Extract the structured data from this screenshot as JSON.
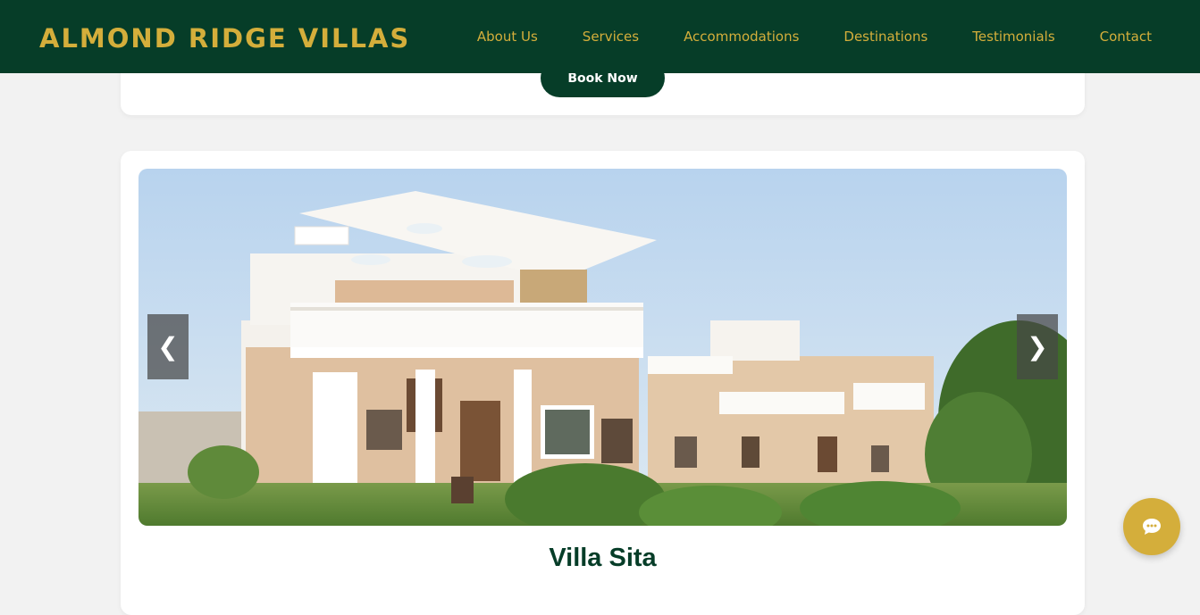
{
  "header": {
    "brand": "ALMOND RIDGE VILLAS",
    "nav": [
      "About Us",
      "Services",
      "Accommodations",
      "Destinations",
      "Testimonials",
      "Contact"
    ]
  },
  "booking": {
    "button_label": "Book Now"
  },
  "villa": {
    "name": "Villa Sita",
    "carousel": {
      "prev_icon": "❮",
      "next_icon": "❯"
    }
  },
  "chat": {
    "icon": "chat-bubble-icon"
  },
  "colors": {
    "primary": "#063d28",
    "accent": "#d4ae3b",
    "background": "#f2f2f2"
  }
}
